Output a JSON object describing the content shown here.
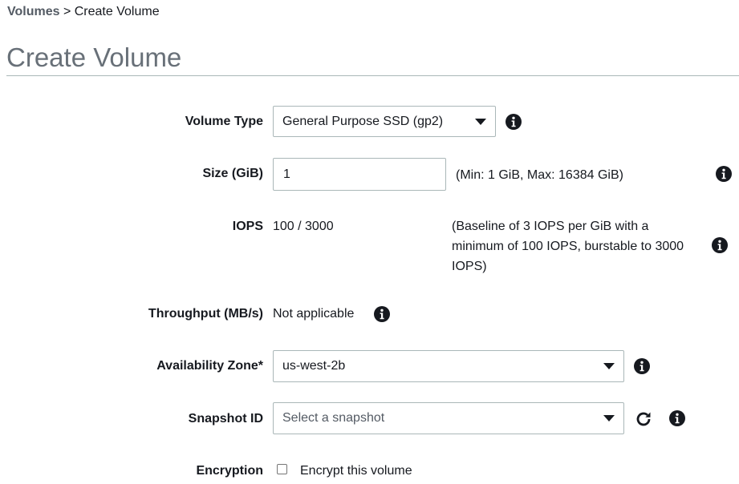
{
  "breadcrumb": {
    "parent": "Volumes",
    "separator": ">",
    "current": "Create Volume"
  },
  "page": {
    "title": "Create Volume"
  },
  "form": {
    "volume_type": {
      "label": "Volume Type",
      "value": "General Purpose SSD (gp2)"
    },
    "size": {
      "label": "Size (GiB)",
      "value": "1",
      "hint": "(Min: 1 GiB, Max: 16384 GiB)"
    },
    "iops": {
      "label": "IOPS",
      "value": "100 / 3000",
      "note": "(Baseline of 3 IOPS per GiB with a minimum of 100 IOPS, burstable to 3000 IOPS)"
    },
    "throughput": {
      "label": "Throughput (MB/s)",
      "value": "Not applicable"
    },
    "availability_zone": {
      "label": "Availability Zone*",
      "value": "us-west-2b"
    },
    "snapshot": {
      "label": "Snapshot ID",
      "placeholder": "Select a snapshot"
    },
    "encryption": {
      "label": "Encryption",
      "checkbox_label": "Encrypt this volume",
      "checked": false
    }
  },
  "icons": {
    "info": "info-icon",
    "refresh": "refresh-icon",
    "dropdown": "caret-down-icon",
    "checkbox": "checkbox-unchecked"
  },
  "colors": {
    "text": "#16191f",
    "title": "#687078",
    "border": "#aab7b8",
    "breadcrumb_link": "#545b64"
  }
}
